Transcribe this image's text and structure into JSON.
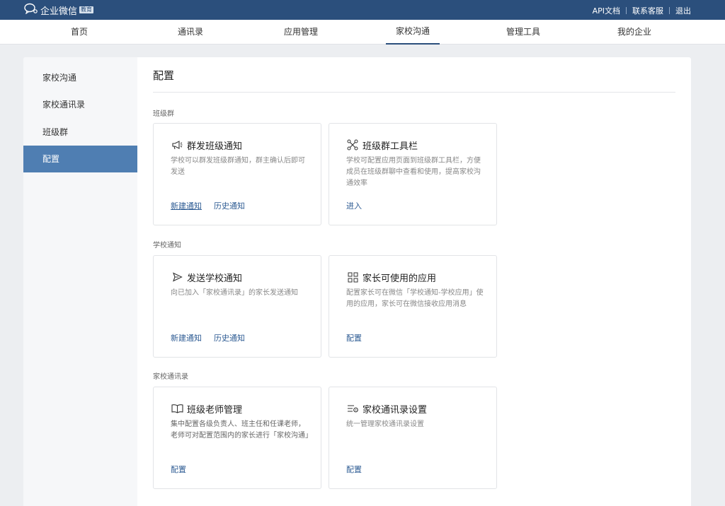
{
  "topbar": {
    "brand": "企业微信",
    "badge": "教育",
    "links": [
      "API文档",
      "联系客服",
      "退出"
    ]
  },
  "nav": {
    "items": [
      "首页",
      "通讯录",
      "应用管理",
      "家校沟通",
      "管理工具",
      "我的企业"
    ],
    "active_index": 3
  },
  "sidebar": {
    "items": [
      "家校沟通",
      "家校通讯录",
      "班级群",
      "配置"
    ],
    "active_index": 3
  },
  "main": {
    "title": "配置",
    "sections": [
      {
        "title": "班级群",
        "cards": [
          {
            "icon": "megaphone-icon",
            "title": "群发班级通知",
            "desc": "学校可以群发班级群通知，群主确认后即可发送",
            "links": [
              "新建通知",
              "历史通知"
            ]
          },
          {
            "icon": "toolbar-icon",
            "title": "班级群工具栏",
            "desc": "学校可配置应用页面到班级群工具栏，方便成员在班级群聊中查看和使用，提高家校沟通效率",
            "links": [
              "进入"
            ]
          }
        ]
      },
      {
        "title": "学校通知",
        "cards": [
          {
            "icon": "send-icon",
            "title": "发送学校通知",
            "desc": "向已加入「家校通讯录」的家长发送通知",
            "links": [
              "新建通知",
              "历史通知"
            ]
          },
          {
            "icon": "apps-grid-icon",
            "title": "家长可使用的应用",
            "desc": "配置家长可在微信「学校通知-学校应用」使用的应用，家长可在微信接收应用消息",
            "links": [
              "配置"
            ]
          }
        ]
      },
      {
        "title": "家校通讯录",
        "cards": [
          {
            "icon": "book-icon",
            "title": "班级老师管理",
            "desc": "集中配置各级负责人、班主任和任课老师，老师可对配置范围内的家长进行「家校沟通」",
            "links": [
              "配置"
            ]
          },
          {
            "icon": "list-settings-icon",
            "title": "家校通讯录设置",
            "desc": "统一管理家校通讯录设置",
            "links": [
              "配置"
            ]
          }
        ]
      }
    ]
  },
  "colors": {
    "topbar": "#2b4f7c",
    "sidebar_active": "#4f7eb2",
    "link": "#2d5b93",
    "page_bg": "#eceef1"
  }
}
